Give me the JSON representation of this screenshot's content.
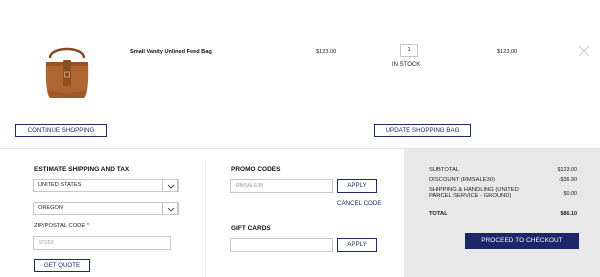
{
  "cart": {
    "item": {
      "name": "Small Vanity Unlined Feed Bag",
      "price": "$123.00",
      "quantity": "1",
      "stock_status": "IN STOCK",
      "total": "$123.00"
    },
    "continue_label": "CONTINUE SHOPPING",
    "update_label": "UPDATE SHOPPING BAG"
  },
  "shipping": {
    "title": "ESTIMATE SHIPPING AND TAX",
    "country": "UNITED STATES",
    "state": "OREGON",
    "zip_label": "ZIP/POSTAL CODE",
    "zip_required_mark": "*",
    "zip_value": "97253",
    "get_quote_label": "GET QUOTE"
  },
  "promo": {
    "title": "PROMO CODES",
    "code_value": "RMSALE30",
    "apply_label": "APPLY",
    "cancel_label": "CANCEL CODE"
  },
  "gift": {
    "title": "GIFT CARDS",
    "apply_label": "APPLY"
  },
  "summary": {
    "subtotal_label": "SUBTOTAL",
    "subtotal_value": "$123.00",
    "discount_label": "DISCOUNT (RMSALE30)",
    "discount_value": "-$36.90",
    "shipping_label_1": "SHIPPING & HANDLING (UNITED",
    "shipping_label_2": "PARCEL SERVICE - GROUND)",
    "shipping_value": "$0.00",
    "total_label": "TOTAL",
    "total_value": "$86.10",
    "checkout_label": "PROCEED TO CHECKOUT"
  },
  "colors": {
    "accent": "#1d2a6b",
    "summary_bg": "#e8e8e8"
  },
  "icons": {
    "product": "feed-bag-image",
    "remove": "close-icon",
    "dropdown": "chevron-down-icon"
  }
}
